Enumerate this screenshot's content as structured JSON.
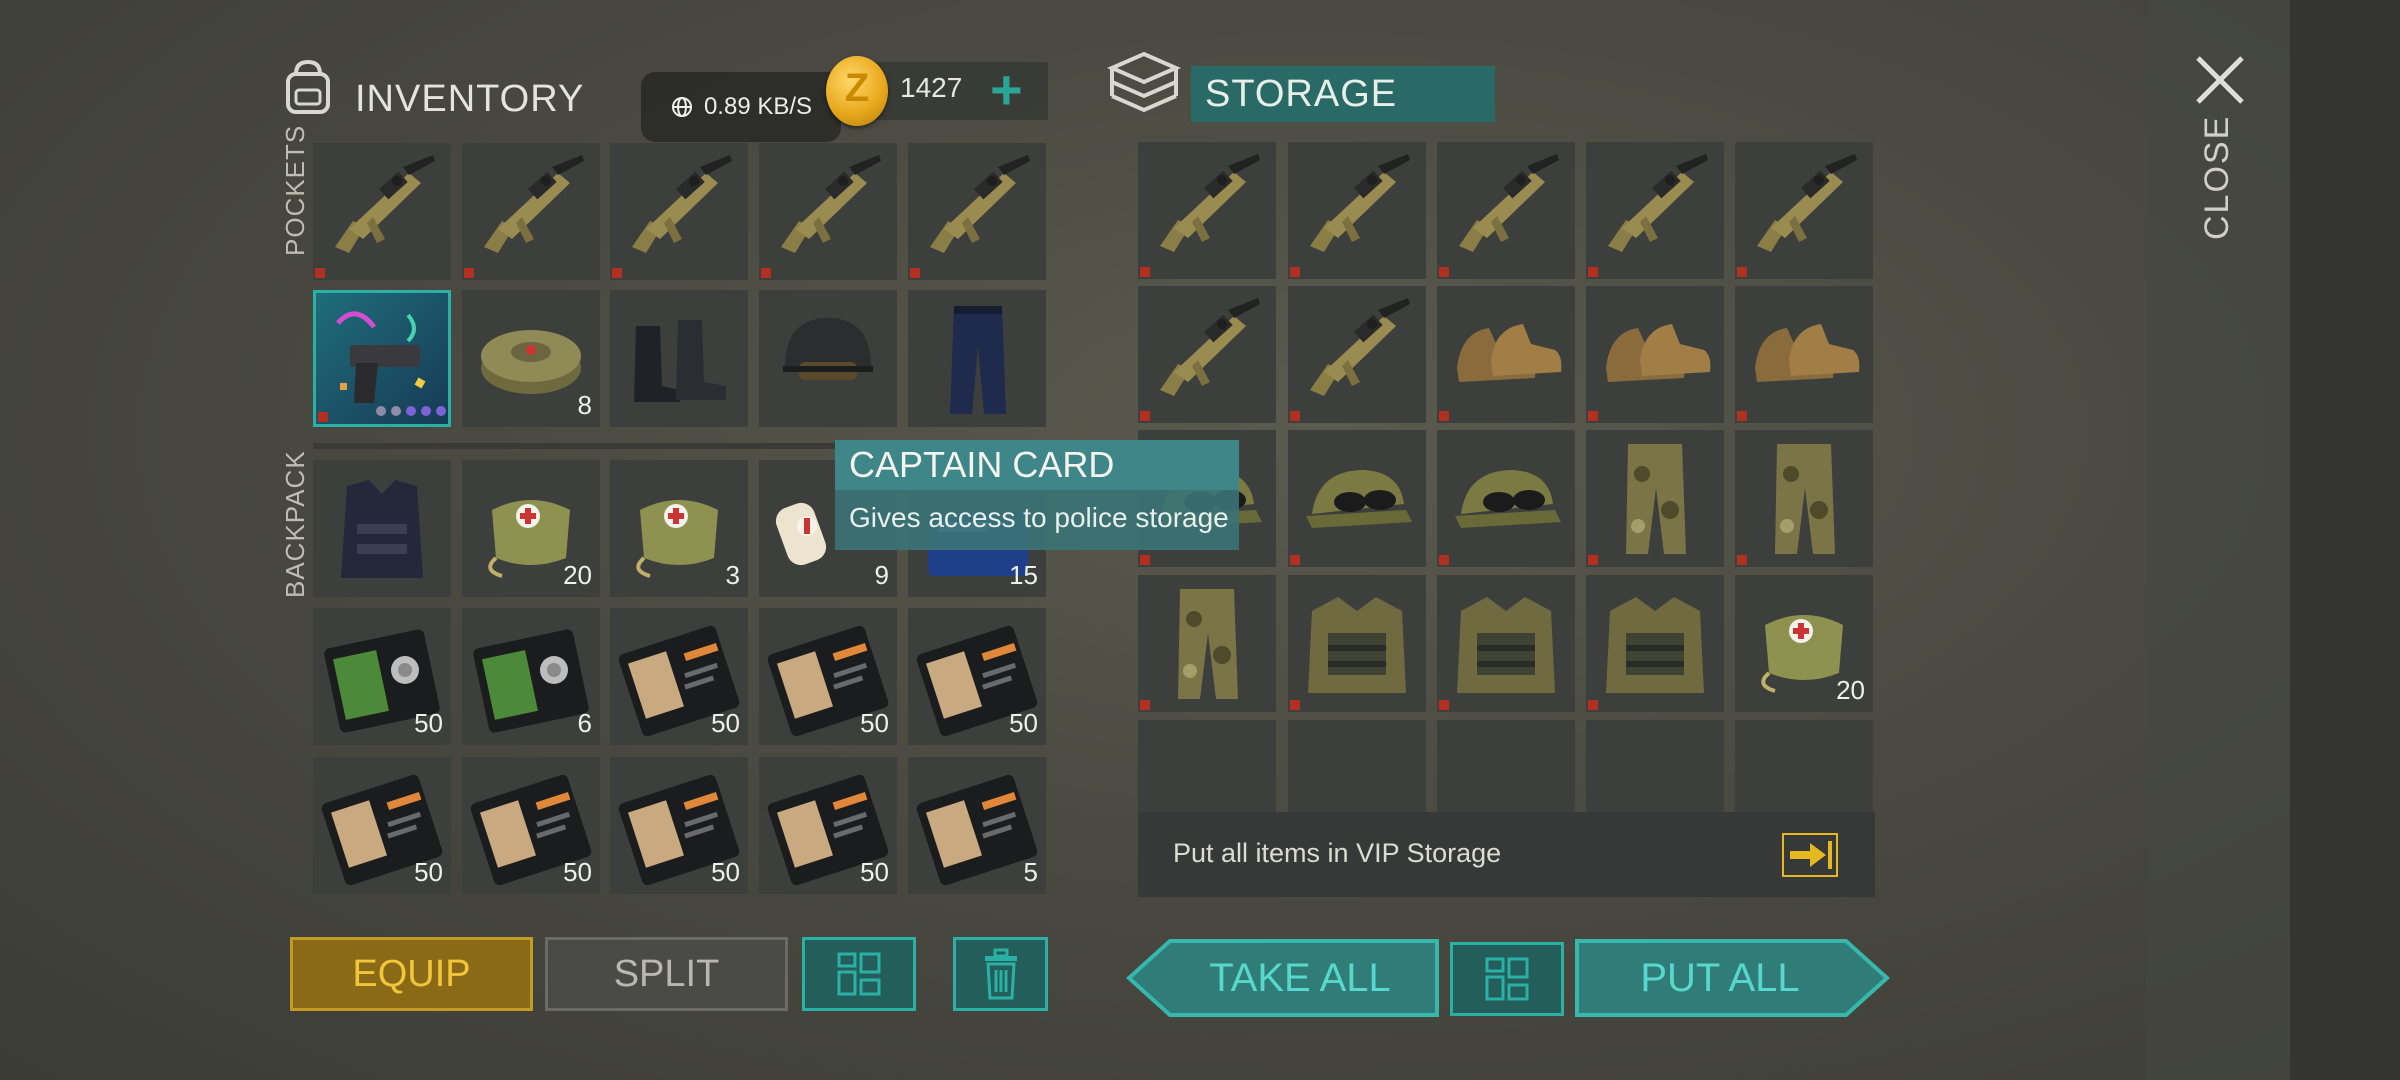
{
  "network": {
    "speed": "0.89 KB/S"
  },
  "inventory": {
    "title": "INVENTORY",
    "currency": {
      "amount": "1427",
      "plus": "+",
      "coin_letter": "Z"
    },
    "pockets_label": "POCKETS",
    "backpack_label": "BACKPACK",
    "pockets": [
      {
        "icon": "rifle",
        "count": "",
        "badge": true
      },
      {
        "icon": "rifle",
        "count": "",
        "badge": true
      },
      {
        "icon": "rifle",
        "count": "",
        "badge": true
      },
      {
        "icon": "rifle",
        "count": "",
        "badge": true
      },
      {
        "icon": "rifle",
        "count": "",
        "badge": true
      },
      {
        "icon": "pistol",
        "count": "",
        "badge": true,
        "selected": true
      },
      {
        "icon": "mine",
        "count": "8",
        "badge": false
      },
      {
        "icon": "boots",
        "count": "",
        "badge": false
      },
      {
        "icon": "helmet",
        "count": "",
        "badge": false
      },
      {
        "icon": "pants",
        "count": "",
        "badge": false
      }
    ],
    "backpack": [
      {
        "icon": "vest",
        "count": ""
      },
      {
        "icon": "medbag",
        "count": "20"
      },
      {
        "icon": "medbag",
        "count": "3"
      },
      {
        "icon": "bandage",
        "count": "9"
      },
      {
        "icon": "card",
        "count": "15"
      },
      {
        "icon": "id-card-green",
        "count": "50"
      },
      {
        "icon": "id-card-green",
        "count": "6"
      },
      {
        "icon": "patrol-card",
        "count": "50"
      },
      {
        "icon": "patrol-card",
        "count": "50"
      },
      {
        "icon": "patrol-card",
        "count": "50"
      },
      {
        "icon": "patrol-card",
        "count": "50"
      },
      {
        "icon": "patrol-card",
        "count": "50"
      },
      {
        "icon": "patrol-card",
        "count": "50"
      },
      {
        "icon": "patrol-card",
        "count": "50"
      },
      {
        "icon": "patrol-card",
        "count": "5"
      }
    ],
    "buttons": {
      "equip": "EQUIP",
      "split": "SPLIT"
    }
  },
  "storage": {
    "title": "STORAGE",
    "slots": [
      {
        "icon": "rifle",
        "count": "",
        "badge": true
      },
      {
        "icon": "rifle",
        "count": "",
        "badge": true
      },
      {
        "icon": "rifle",
        "count": "",
        "badge": true
      },
      {
        "icon": "rifle",
        "count": "",
        "badge": true
      },
      {
        "icon": "rifle",
        "count": "",
        "badge": true
      },
      {
        "icon": "rifle",
        "count": "",
        "badge": true
      },
      {
        "icon": "rifle",
        "count": "",
        "badge": true
      },
      {
        "icon": "shoes",
        "count": "",
        "badge": true
      },
      {
        "icon": "shoes",
        "count": "",
        "badge": true
      },
      {
        "icon": "shoes",
        "count": "",
        "badge": true
      },
      {
        "icon": "cap",
        "count": "",
        "badge": true
      },
      {
        "icon": "cap",
        "count": "",
        "badge": true
      },
      {
        "icon": "cap",
        "count": "",
        "badge": true
      },
      {
        "icon": "camo-pants",
        "count": "",
        "badge": true
      },
      {
        "icon": "camo-pants",
        "count": "",
        "badge": true
      },
      {
        "icon": "camo-pants",
        "count": "",
        "badge": true
      },
      {
        "icon": "camo-vest",
        "count": "",
        "badge": true
      },
      {
        "icon": "camo-vest",
        "count": "",
        "badge": true
      },
      {
        "icon": "camo-vest",
        "count": "",
        "badge": true
      },
      {
        "icon": "medbag",
        "count": "20",
        "badge": false
      },
      {
        "icon": "",
        "count": ""
      },
      {
        "icon": "",
        "count": ""
      },
      {
        "icon": "",
        "count": ""
      },
      {
        "icon": "",
        "count": ""
      },
      {
        "icon": "",
        "count": ""
      }
    ],
    "vip_text": "Put all items in VIP Storage",
    "buttons": {
      "take_all": "TAKE ALL",
      "put_all": "PUT ALL"
    }
  },
  "tooltip": {
    "title": "CAPTAIN CARD",
    "description": "Gives access to police storage"
  },
  "close": {
    "label": "CLOSE"
  },
  "colors": {
    "accent": "#2bb0a6",
    "equip": "#c39a22",
    "badge": "#b23022"
  }
}
